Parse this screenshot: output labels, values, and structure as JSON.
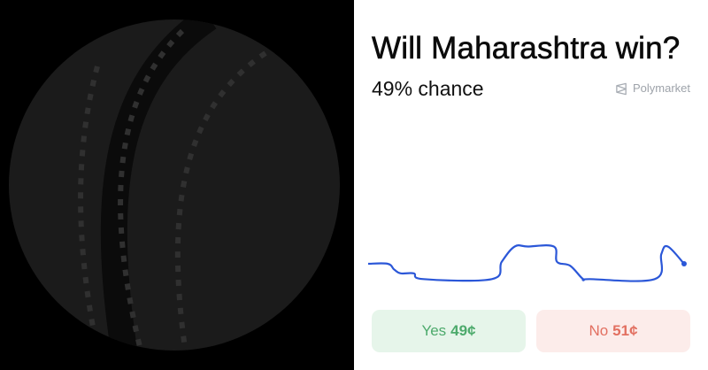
{
  "market": {
    "question": "Will Maharashtra win?",
    "chance_label": "49% chance",
    "chance_percent": 49
  },
  "brand": {
    "name": "Polymarket",
    "icon": "polymarket-logo-icon"
  },
  "left_image": {
    "icon": "cricket-ball-icon"
  },
  "chart_data": {
    "type": "line",
    "title": "",
    "xlabel": "",
    "ylabel": "",
    "ylim": [
      0,
      100
    ],
    "grid": false,
    "legend": "none",
    "series": [
      {
        "color": "#2b57d8",
        "x": [
          0,
          6,
          8,
          10,
          14,
          17,
          38,
          41,
          45,
          49,
          57,
          58,
          62,
          66,
          68,
          88,
          90,
          92,
          97
        ],
        "values": [
          50,
          50,
          47,
          45,
          45,
          42,
          42,
          51,
          59,
          59,
          59,
          51,
          49,
          42,
          42,
          42,
          55,
          59,
          50
        ]
      }
    ]
  },
  "buttons": {
    "yes_label": "Yes",
    "yes_price": "49¢",
    "no_label": "No",
    "no_price": "51¢"
  },
  "colors": {
    "line": "#2b57d8",
    "yes_bg": "#e6f5ea",
    "yes_text": "#4daa6c",
    "no_bg": "#fcecea",
    "no_text": "#e27061"
  }
}
